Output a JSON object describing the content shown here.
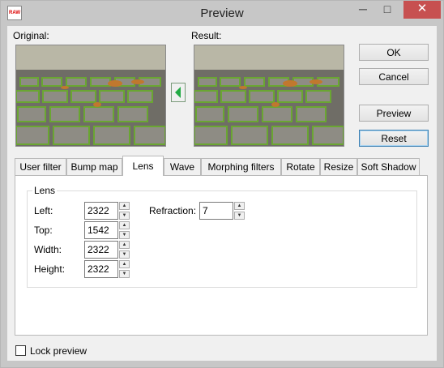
{
  "window": {
    "title": "Preview",
    "app_icon": "RAW"
  },
  "titlebar": {
    "minimize": "─",
    "maximize": "□",
    "close": "✕"
  },
  "images": {
    "original_label": "Original:",
    "result_label": "Result:"
  },
  "buttons": {
    "ok": "OK",
    "cancel": "Cancel",
    "preview": "Preview",
    "reset": "Reset"
  },
  "tabs": [
    "User filter",
    "Bump map",
    "Lens",
    "Wave",
    "Morphing filters",
    "Rotate",
    "Resize",
    "Soft Shadow"
  ],
  "active_tab": "Lens",
  "lens": {
    "group_title": "Lens",
    "left_label": "Left:",
    "left_value": "2322",
    "top_label": "Top:",
    "top_value": "1542",
    "width_label": "Width:",
    "width_value": "2322",
    "height_label": "Height:",
    "height_value": "2322",
    "refraction_label": "Refraction:",
    "refraction_value": "7"
  },
  "lock_preview": {
    "label": "Lock preview",
    "checked": false
  },
  "colors": {
    "arrow": "#22aa44",
    "close_button": "#c75050"
  }
}
